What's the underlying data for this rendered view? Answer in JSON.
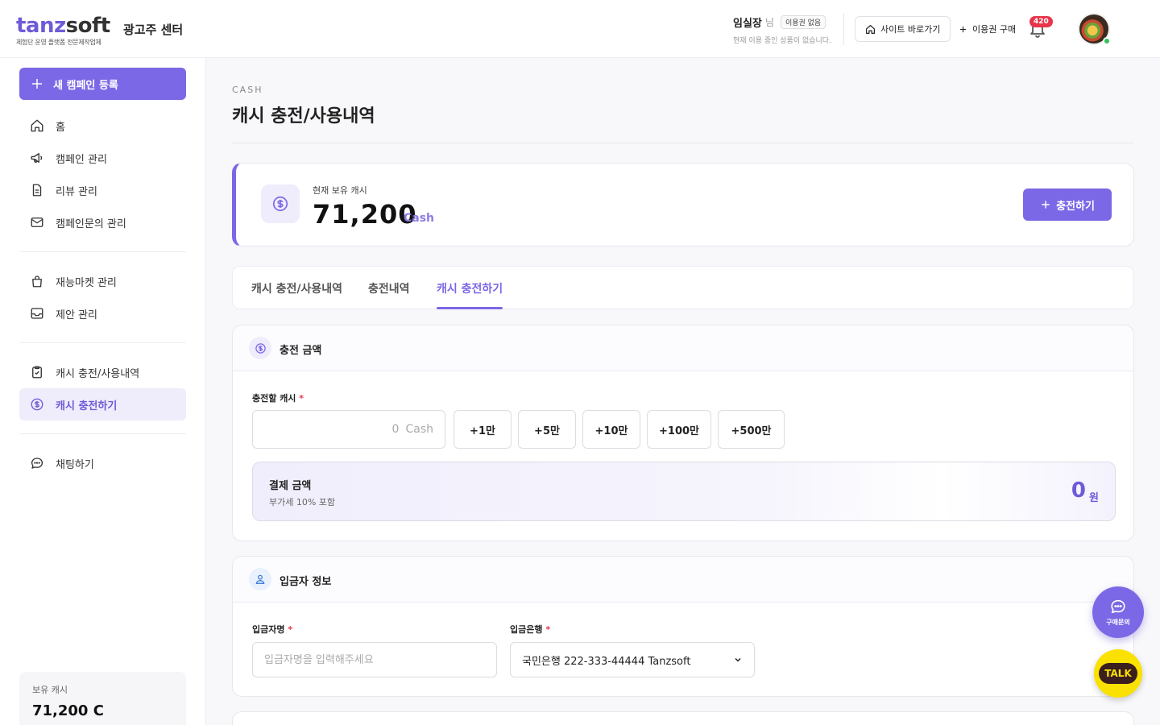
{
  "header": {
    "logo_tan": "tanz",
    "logo_soft": "soft",
    "logo_tagline": "체험단 운영 플랫폼 전문제작업체",
    "center_name": "광고주 센터",
    "user_name": "임실장",
    "user_suffix": "님",
    "plan_badge": "이용권 없음",
    "plan_note": "현재 이용 중인 상품이 없습니다.",
    "site_button": "사이트 바로가기",
    "ticket_button": "이용권 구매",
    "notification_count": "420"
  },
  "sidebar": {
    "new_campaign": "새 캠페인 등록",
    "groups": [
      [
        {
          "label": "홈",
          "icon": "home-icon"
        },
        {
          "label": "캠페인 관리",
          "icon": "megaphone-icon"
        },
        {
          "label": "리뷰 관리",
          "icon": "document-icon"
        },
        {
          "label": "캠페인문의 관리",
          "icon": "mail-icon"
        }
      ],
      [
        {
          "label": "재능마켓 관리",
          "icon": "shopping-bag-icon"
        },
        {
          "label": "제안 관리",
          "icon": "inbox-icon"
        }
      ],
      [
        {
          "label": "캐시 충전/사용내역",
          "icon": "clipboard-check-icon"
        },
        {
          "label": "캐시 충전하기",
          "icon": "dollar-circle-icon",
          "active": true
        }
      ],
      [
        {
          "label": "채팅하기",
          "icon": "chat-icon"
        }
      ]
    ],
    "cash_label": "보유 캐시",
    "cash_value": "71,200 C"
  },
  "page": {
    "eyebrow": "CASH",
    "title": "캐시 충전/사용내역"
  },
  "balance": {
    "label": "현재 보유 캐시",
    "value": "71,200",
    "unit": "Cash",
    "charge_button": "충전하기"
  },
  "tabs": [
    {
      "label": "캐시 충전/사용내역",
      "active": false
    },
    {
      "label": "충전내역",
      "active": false
    },
    {
      "label": "캐시 충전하기",
      "active": true
    }
  ],
  "charge_section": {
    "title": "충전 금액",
    "field_label": "충전할 캐시",
    "required_mark": "*",
    "input_placeholder": "0",
    "input_unit": "Cash",
    "quick_buttons": [
      "+1만",
      "+5만",
      "+10만",
      "+100만",
      "+500만"
    ],
    "pay_label": "결제 금액",
    "pay_note": "부가세 10% 포함",
    "pay_value": "0",
    "pay_unit": "원"
  },
  "depositor_section": {
    "title": "입금자 정보",
    "name_label": "입금자명",
    "name_placeholder": "입금자명을 입력해주세요",
    "bank_label": "입금은행",
    "bank_selected": "국민은행 222-333-44444 Tanzsoft",
    "required_mark": "*"
  },
  "fab": {
    "inquiry": "구매문의",
    "talk": "TALK"
  },
  "colors": {
    "accent": "#7b68e6",
    "accent_light": "#efecfc",
    "badge_red": "#e8354a",
    "kakao_yellow": "#fae100"
  }
}
